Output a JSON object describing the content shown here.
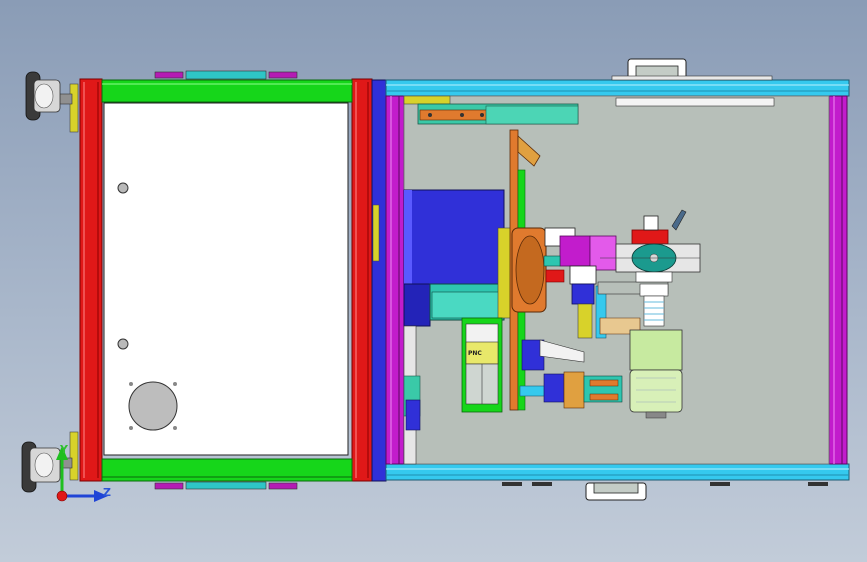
{
  "triad": {
    "y_label": "Y",
    "z_label": "Z"
  },
  "parts": {
    "valve_label": "PNC"
  },
  "colors": {
    "frame_red": "#e01818",
    "rail_green": "#16d61a",
    "rail_cyan": "#35c9ee",
    "rail_magenta": "#c21ccc",
    "motor_blue": "#3030d8",
    "plate_grey": "#b7bfb9",
    "panel_white": "#ffffff",
    "bracket_orange": "#e07a2e",
    "base_teal": "#2ec6b0"
  }
}
